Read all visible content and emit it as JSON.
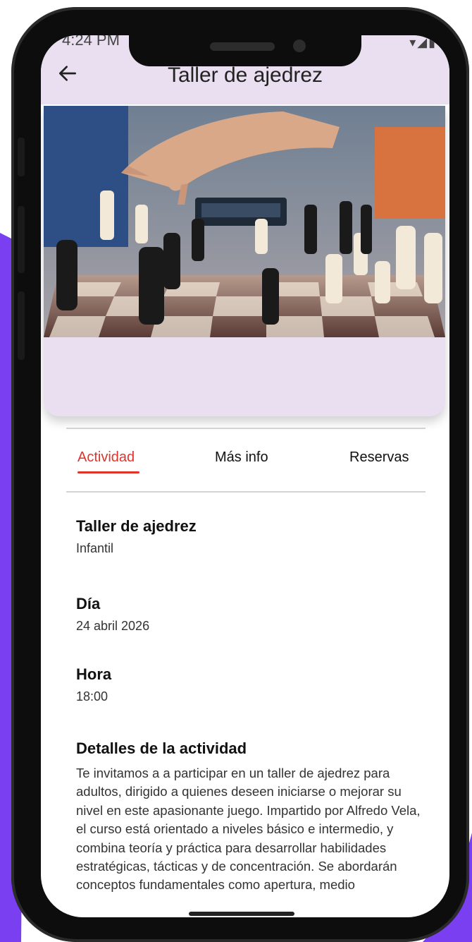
{
  "status_bar": {
    "time": "4:24 PM",
    "icons": "▾◢▮"
  },
  "app_bar": {
    "title": "Taller de ajedrez",
    "back_icon": "arrow-left"
  },
  "hero": {
    "image": "chess-board-photo"
  },
  "tabs": [
    {
      "label": "Actividad",
      "active": true
    },
    {
      "label": "Más info",
      "active": false
    },
    {
      "label": "Reservas",
      "active": false
    }
  ],
  "activity": {
    "name": "Taller de ajedrez",
    "category": "Infantil",
    "day_label": "Día",
    "day_value": "24 abril 2026",
    "time_label": "Hora",
    "time_value": "18:00",
    "details_label": "Detalles de la actividad",
    "details_text": "Te invitamos a a participar en un taller de ajedrez para adultos, dirigido a quienes deseen iniciarse o mejorar su nivel en este apasionante juego. Impartido por Alfredo Vela, el curso está orientado a niveles básico e intermedio, y combina teoría y práctica para desarrollar habilidades estratégicas, tácticas y de concentración.  Se abordarán conceptos fundamentales como apertura, medio"
  },
  "colors": {
    "accent": "#e0342b",
    "appbar": "#e9dff0",
    "background_accent": "#7b3ff2"
  }
}
